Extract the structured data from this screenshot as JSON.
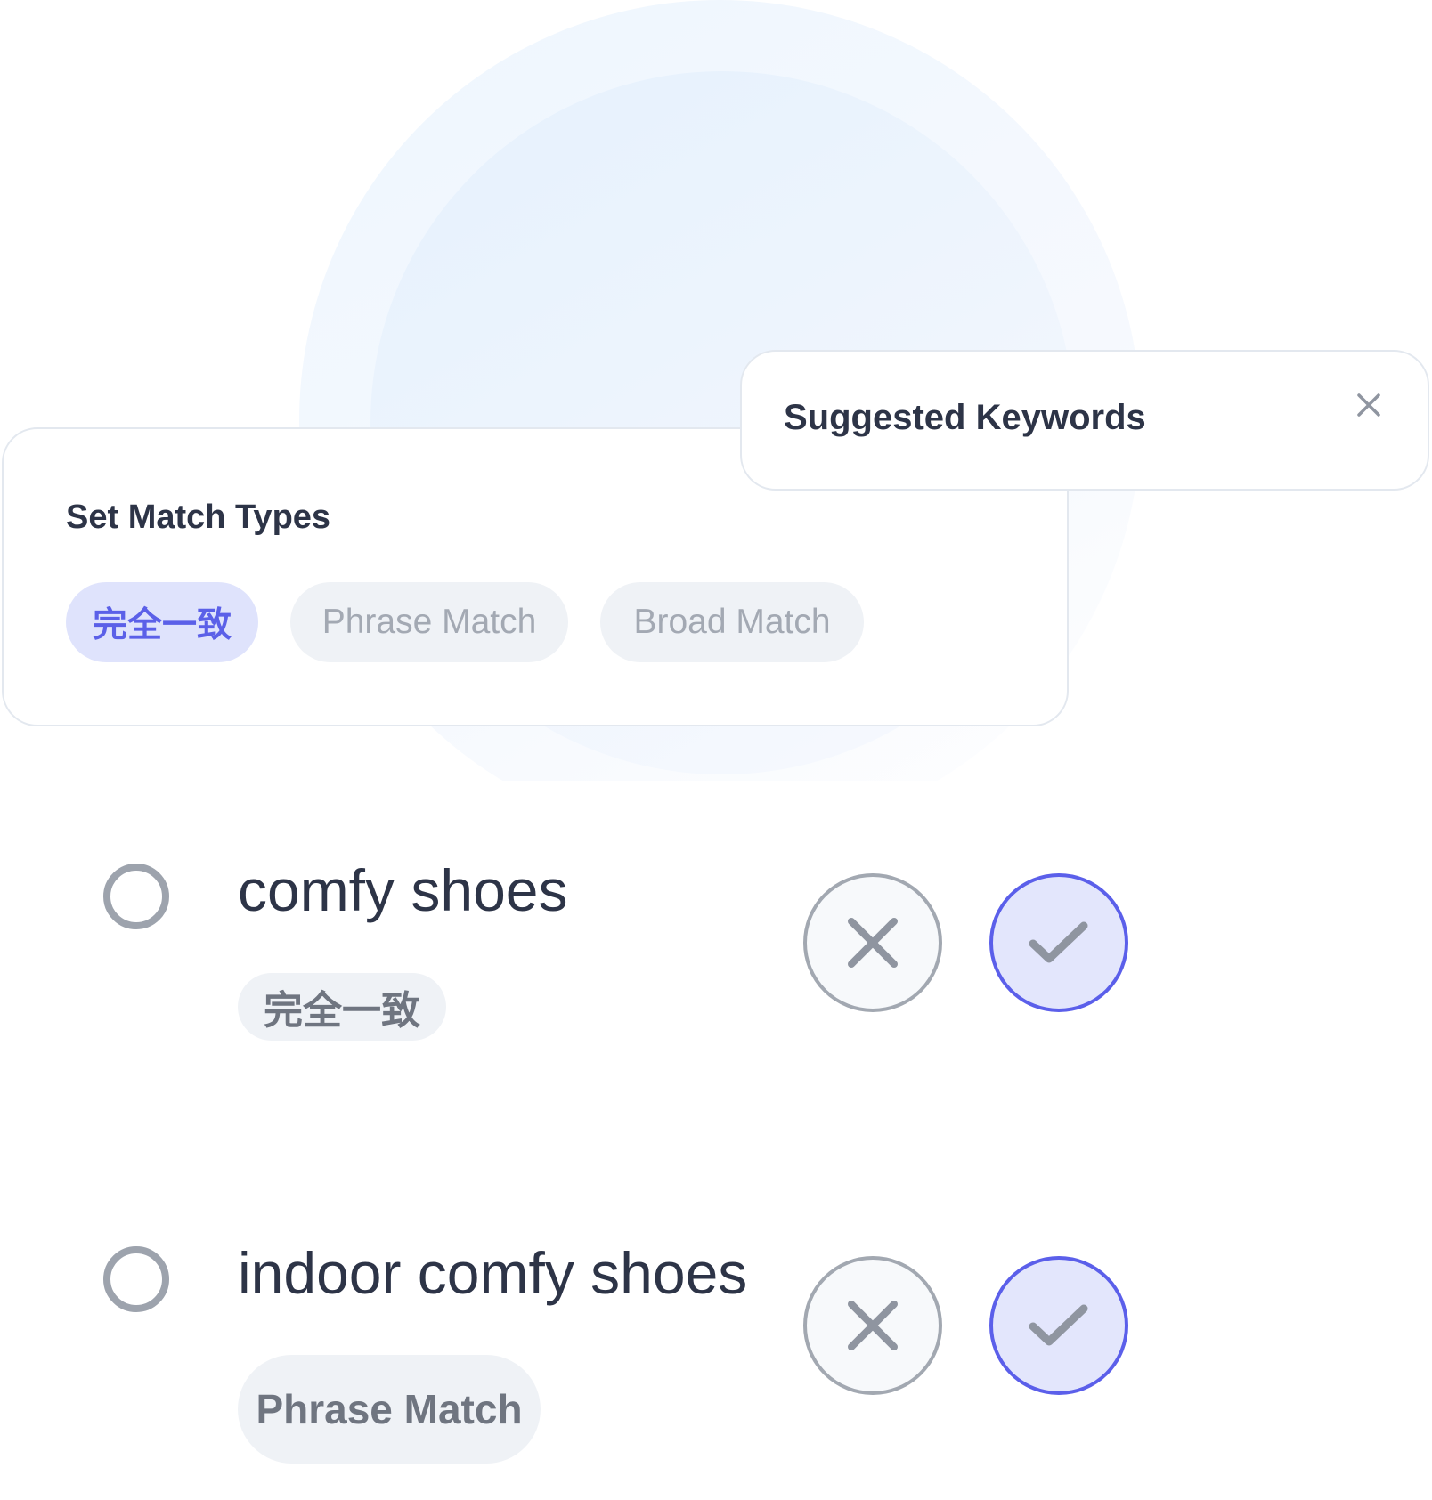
{
  "match_types_card": {
    "title": "Set Match Types",
    "options": [
      {
        "label": "完全一致",
        "selected": true
      },
      {
        "label": "Phrase Match",
        "selected": false
      },
      {
        "label": "Broad Match",
        "selected": false
      }
    ]
  },
  "suggested_card": {
    "title": "Suggested Keywords",
    "close_icon": "close-icon"
  },
  "keywords": [
    {
      "text": "comfy shoes",
      "match_type": "完全一致",
      "selected": false
    },
    {
      "text": "indoor comfy shoes",
      "match_type": "Phrase Match",
      "selected": false
    }
  ],
  "colors": {
    "accent": "#5b5fea",
    "accent_bg": "#e3e6fc",
    "text": "#2d3447",
    "muted": "#a3a9b3",
    "pill_bg": "#eff2f6"
  }
}
